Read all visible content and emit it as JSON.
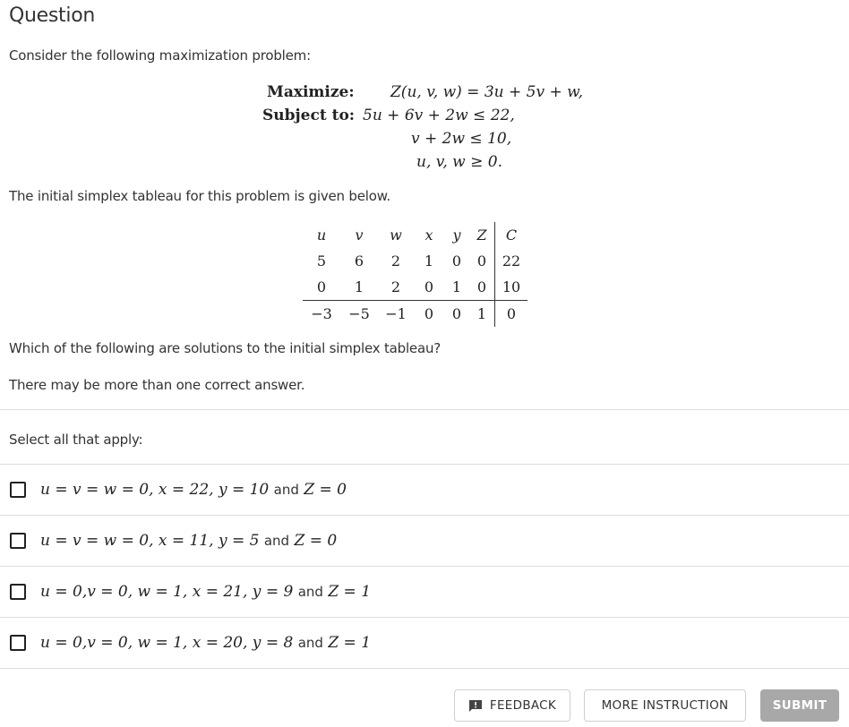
{
  "header": {
    "title": "Question"
  },
  "intro": "Consider the following maximization problem:",
  "problem": {
    "maximize_label": "Maximize:",
    "objective": "Z(u, v, w) = 3u + 5v + w,",
    "subject_label": "Subject to:",
    "constraints": [
      "5u + 6v + 2w ≤ 22,",
      "v + 2w ≤ 10,",
      "u, v, w ≥ 0."
    ]
  },
  "tableau_intro": "The initial simplex tableau for this problem is given below.",
  "tableau": {
    "headers": [
      "u",
      "v",
      "w",
      "x",
      "y",
      "Z",
      "C"
    ],
    "rows": [
      [
        "5",
        "6",
        "2",
        "1",
        "0",
        "0",
        "22"
      ],
      [
        "0",
        "1",
        "2",
        "0",
        "1",
        "0",
        "10"
      ],
      [
        "−3",
        "−5",
        "−1",
        "0",
        "0",
        "1",
        "0"
      ]
    ]
  },
  "question": "Which of the following are solutions to the initial simplex tableau?",
  "hint": "There may be more than one correct answer.",
  "select_label": "Select all that apply:",
  "options": [
    {
      "math": "u = v = w = 0, x = 22, y = 10",
      "and": "and",
      "tail": "Z = 0",
      "checked": false
    },
    {
      "math": "u = v = w = 0, x = 11, y = 5",
      "and": "and",
      "tail": "Z = 0",
      "checked": false
    },
    {
      "math": "u = 0,v = 0, w = 1, x = 21, y = 9",
      "and": "and",
      "tail": "Z = 1",
      "checked": false
    },
    {
      "math": "u = 0,v = 0, w = 1, x = 20, y = 8",
      "and": "and",
      "tail": "Z = 1",
      "checked": false
    }
  ],
  "buttons": {
    "feedback": "FEEDBACK",
    "more_instruction": "MORE INSTRUCTION",
    "submit": "SUBMIT"
  },
  "colors": {
    "text": "#333333",
    "divider": "#dddddd",
    "submit_disabled": "#a8a8a8"
  }
}
